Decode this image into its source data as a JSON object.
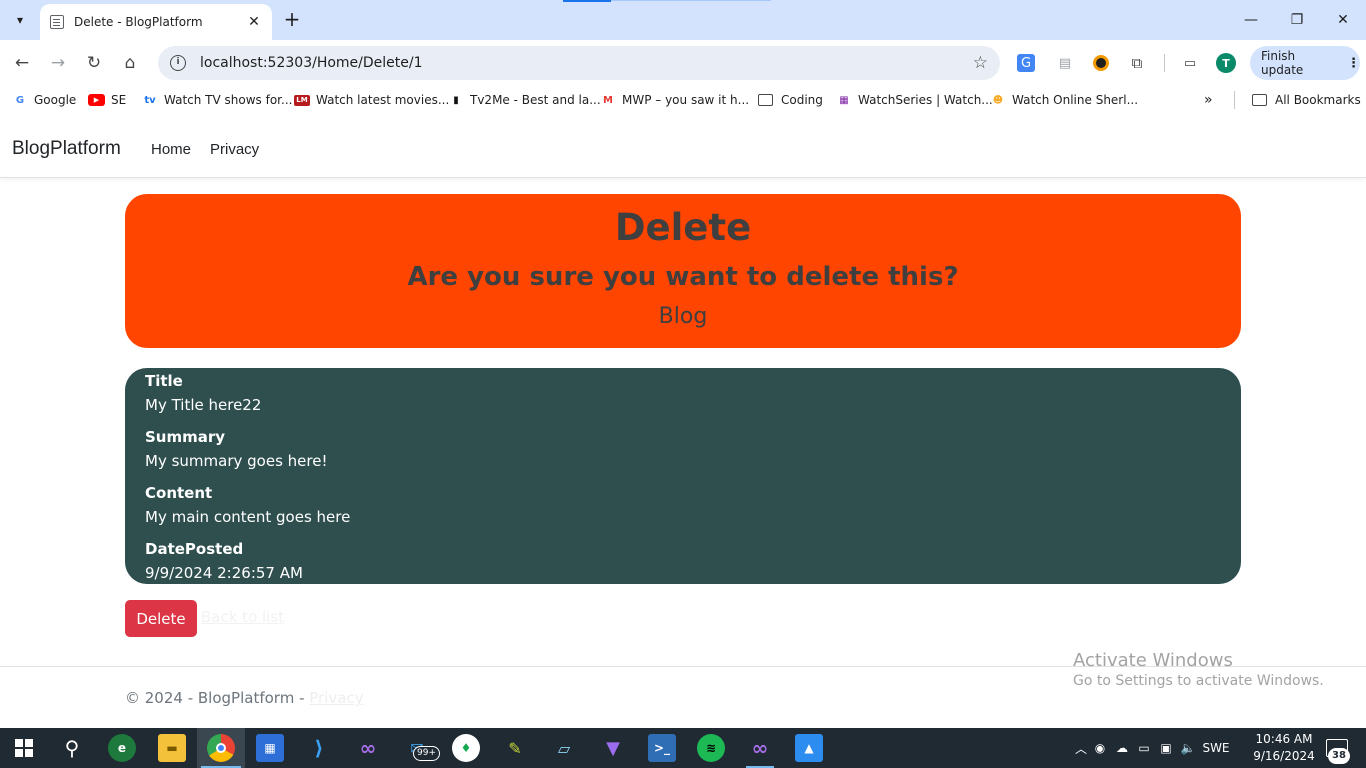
{
  "browser": {
    "tab_title": "Delete - BlogPlatform",
    "url": "localhost:52303/Home/Delete/1",
    "finish_update_label": "Finish update",
    "profile_initial": "T",
    "bookmarks": [
      {
        "label": "Google",
        "icon": "google-icon",
        "color": "#4285f4"
      },
      {
        "label": "SE",
        "icon": "youtube-icon",
        "color": "#ff0000"
      },
      {
        "label": "Watch TV shows for...",
        "icon": "tv-icon",
        "color": "#1a73e8"
      },
      {
        "label": "Watch latest movies...",
        "icon": "movie-icon",
        "color": "#b71c1c"
      },
      {
        "label": "Tv2Me - Best and la...",
        "icon": "tv2me-icon",
        "color": "#111111"
      },
      {
        "label": "MWP – you saw it h...",
        "icon": "mwp-icon",
        "color": "#e53935"
      },
      {
        "label": "Coding",
        "icon": "folder-icon",
        "color": "#444746"
      },
      {
        "label": "WatchSeries | Watch...",
        "icon": "watchseries-icon",
        "color": "#7b1fa2"
      },
      {
        "label": "Watch Online Sherl...",
        "icon": "sherlock-icon",
        "color": "#f9a825"
      }
    ],
    "all_bookmarks_label": "All Bookmarks"
  },
  "site": {
    "brand": "BlogPlatform",
    "nav": [
      {
        "label": "Home"
      },
      {
        "label": "Privacy"
      }
    ]
  },
  "header": {
    "title": "Delete",
    "question": "Are you sure you want to delete this?",
    "entity": "Blog",
    "bg_color": "#ff4500"
  },
  "details": {
    "bg_color": "#2f4f4f",
    "fields": [
      {
        "label": "Title",
        "value": "My Title here22"
      },
      {
        "label": "Summary",
        "value": "My summary goes here!"
      },
      {
        "label": "Content",
        "value": "My main content goes here"
      },
      {
        "label": "DatePosted",
        "value": "9/9/2024 2:26:57 AM"
      }
    ]
  },
  "actions": {
    "delete_label": "Delete",
    "back_label": "Back to list",
    "delete_color": "#dc3545"
  },
  "footer": {
    "copyright": "© 2024 - BlogPlatform - ",
    "privacy_label": "Privacy"
  },
  "watermark": {
    "line1": "Activate Windows",
    "line2": "Go to Settings to activate Windows."
  },
  "taskbar": {
    "language": "SWE",
    "time": "10:46 AM",
    "date": "9/16/2024",
    "mail_badge": "99+",
    "notification_count": "38"
  }
}
